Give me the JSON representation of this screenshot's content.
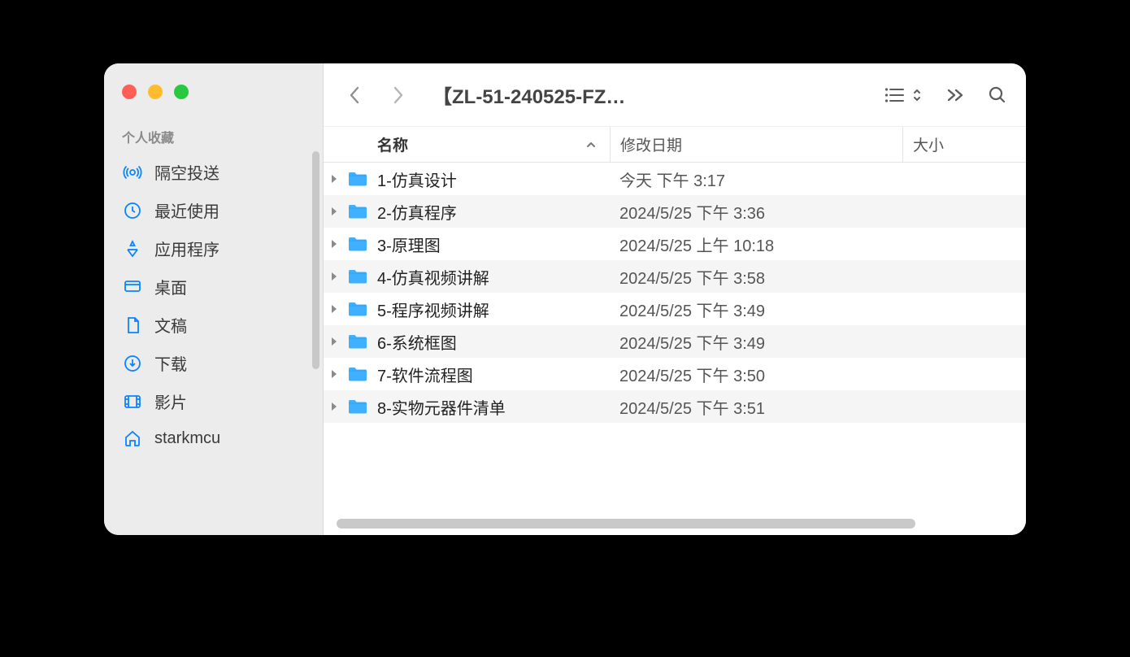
{
  "sidebar": {
    "section_title": "个人收藏",
    "items": [
      {
        "label": "隔空投送",
        "icon": "airdrop-icon"
      },
      {
        "label": "最近使用",
        "icon": "clock-icon"
      },
      {
        "label": "应用程序",
        "icon": "apps-icon"
      },
      {
        "label": "桌面",
        "icon": "desktop-icon"
      },
      {
        "label": "文稿",
        "icon": "documents-icon"
      },
      {
        "label": "下载",
        "icon": "downloads-icon"
      },
      {
        "label": "影片",
        "icon": "movies-icon"
      },
      {
        "label": "starkmcu",
        "icon": "home-icon"
      }
    ]
  },
  "toolbar": {
    "title": "【ZL-51-240525-FZ…"
  },
  "columns": {
    "name": "名称",
    "date": "修改日期",
    "size": "大小"
  },
  "files": [
    {
      "name": "1-仿真设计",
      "date": "今天 下午 3:17",
      "size": ""
    },
    {
      "name": "2-仿真程序",
      "date": "2024/5/25 下午 3:36",
      "size": ""
    },
    {
      "name": "3-原理图",
      "date": "2024/5/25 上午 10:18",
      "size": ""
    },
    {
      "name": "4-仿真视频讲解",
      "date": "2024/5/25 下午 3:58",
      "size": ""
    },
    {
      "name": "5-程序视频讲解",
      "date": "2024/5/25 下午 3:49",
      "size": ""
    },
    {
      "name": "6-系统框图",
      "date": "2024/5/25 下午 3:49",
      "size": ""
    },
    {
      "name": "7-软件流程图",
      "date": "2024/5/25 下午 3:50",
      "size": ""
    },
    {
      "name": "8-实物元器件清单",
      "date": "2024/5/25 下午 3:51",
      "size": ""
    }
  ]
}
